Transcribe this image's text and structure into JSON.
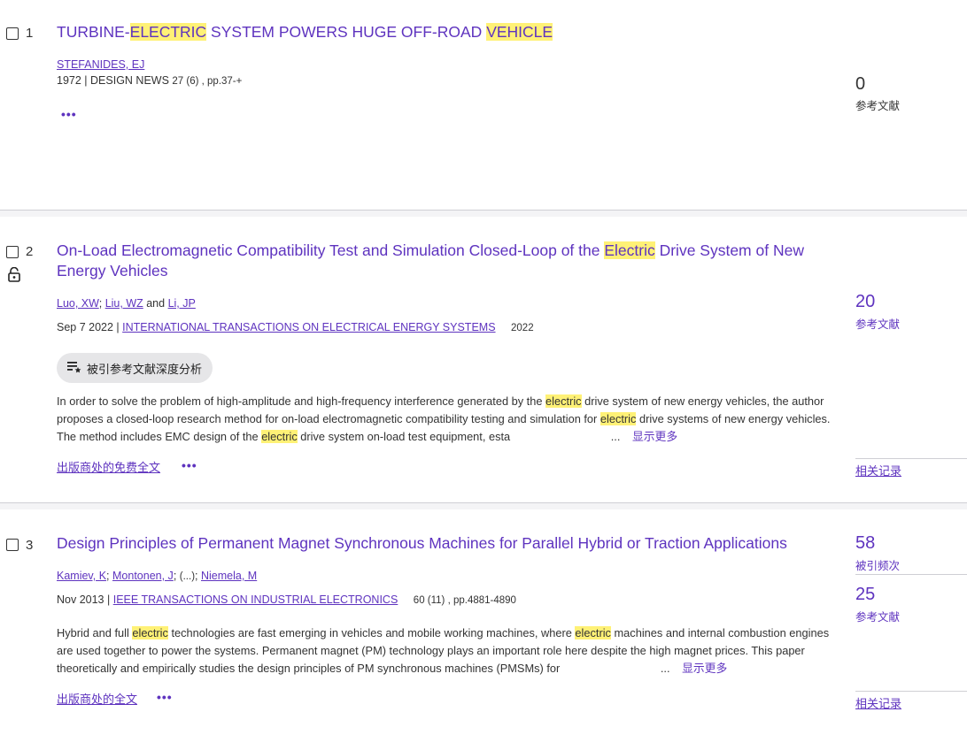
{
  "records": [
    {
      "index": "1",
      "title_parts": [
        "TURBINE-",
        "ELECTRIC",
        " SYSTEM POWERS HUGE OFF-ROAD ",
        "VEHICLE",
        ""
      ],
      "authors": [
        "STEFANIDES, EJ"
      ],
      "year": "1972",
      "journal": "DESIGN NEWS",
      "volume": "27 (6) , pp.37-+",
      "more": "•••",
      "metric": {
        "value": "0",
        "label": "参考文献"
      }
    },
    {
      "index": "2",
      "title_parts": [
        "On-Load Electromagnetic Compatibility Test and Simulation Closed-Loop of the ",
        "Electric",
        " Drive System of New Energy Vehicles"
      ],
      "authors": [
        "Luo, XW",
        "Liu, WZ",
        "Li, JP"
      ],
      "author_sep": ";",
      "author_and": "and",
      "date": "Sep 7 2022",
      "journal": "INTERNATIONAL TRANSACTIONS ON ELECTRICAL ENERGY SYSTEMS",
      "year_extra": "2022",
      "cite_button": "被引参考文献深度分析",
      "abstract_parts": [
        "In order to solve the problem of high-amplitude and high-frequency interference generated by the ",
        "electric",
        " drive system of new energy vehicles, the author proposes a closed-loop research method for on-load electromagnetic compatibility testing and simulation for ",
        "electric",
        " drive systems of new energy vehicles. The method includes EMC design of the ",
        "electric",
        " drive system on-load test equipment, esta"
      ],
      "ellipsis": "...",
      "show_more": "显示更多",
      "fulltext": "出版商处的免费全文",
      "more": "•••",
      "metric": {
        "value": "20",
        "label": "参考文献"
      },
      "related": "相关记录"
    },
    {
      "index": "3",
      "title": "Design Principles of Permanent Magnet Synchronous Machines for Parallel Hybrid or Traction Applications",
      "authors": [
        "Kamiev, K",
        "Montonen, J",
        "Niemela, M"
      ],
      "author_sep": ";",
      "author_ellipsis": "(...)",
      "date": "Nov 2013",
      "journal": "IEEE TRANSACTIONS ON INDUSTRIAL ELECTRONICS",
      "volume": "60 (11) , pp.4881-4890",
      "abstract_parts": [
        "Hybrid and full ",
        "electric",
        " technologies are fast emerging in vehicles and mobile working machines, where ",
        "electric",
        " machines and internal combustion engines are used together to power the systems. Permanent magnet (PM) technology plays an important role here despite the high magnet prices. This paper theoretically and empirically studies the design principles of PM synchronous machines (PMSMs) for"
      ],
      "ellipsis": "...",
      "show_more": "显示更多",
      "fulltext": "出版商处的全文",
      "more": "•••",
      "metrics": [
        {
          "value": "58",
          "label": "被引频次"
        },
        {
          "value": "25",
          "label": "参考文献"
        }
      ],
      "related": "相关记录"
    }
  ],
  "colors": {
    "accent": "#5e33bf",
    "highlight": "#fff176",
    "button_bg": "#e6e6e8"
  },
  "icons": {
    "lock": "lock-open-icon",
    "cite_analysis": "list-star-icon"
  }
}
